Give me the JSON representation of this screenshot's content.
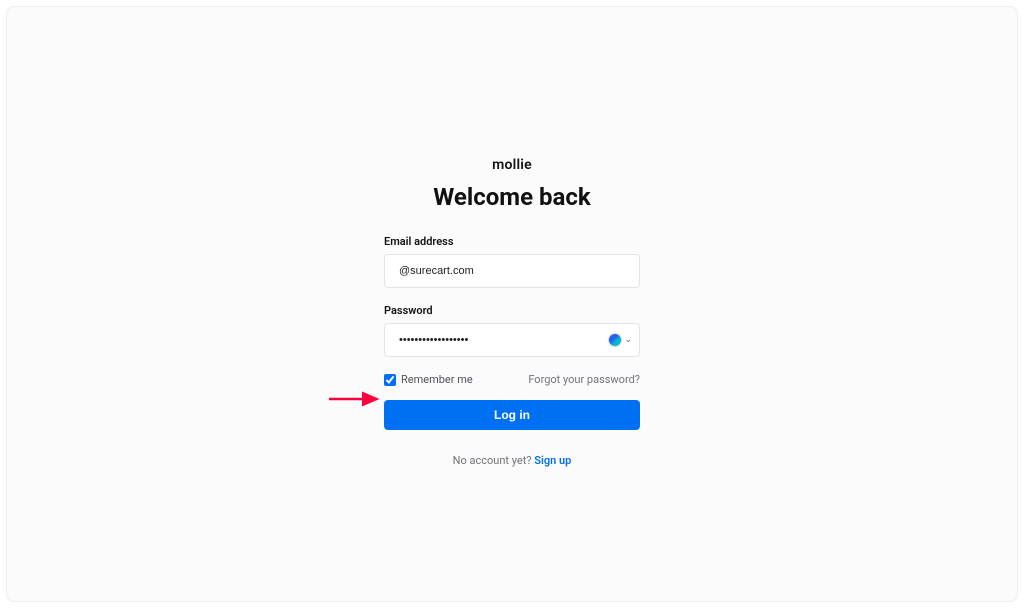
{
  "brand": "mollie",
  "heading": "Welcome back",
  "form": {
    "email": {
      "label": "Email address",
      "value": "@surecart.com"
    },
    "password": {
      "label": "Password",
      "value": "••••••••••••••••••"
    },
    "remember": {
      "label": "Remember me",
      "checked": true
    },
    "forgot_label": "Forgot your password?",
    "login_label": "Log in",
    "no_account_text": "No account yet? ",
    "signup_label": "Sign up"
  }
}
